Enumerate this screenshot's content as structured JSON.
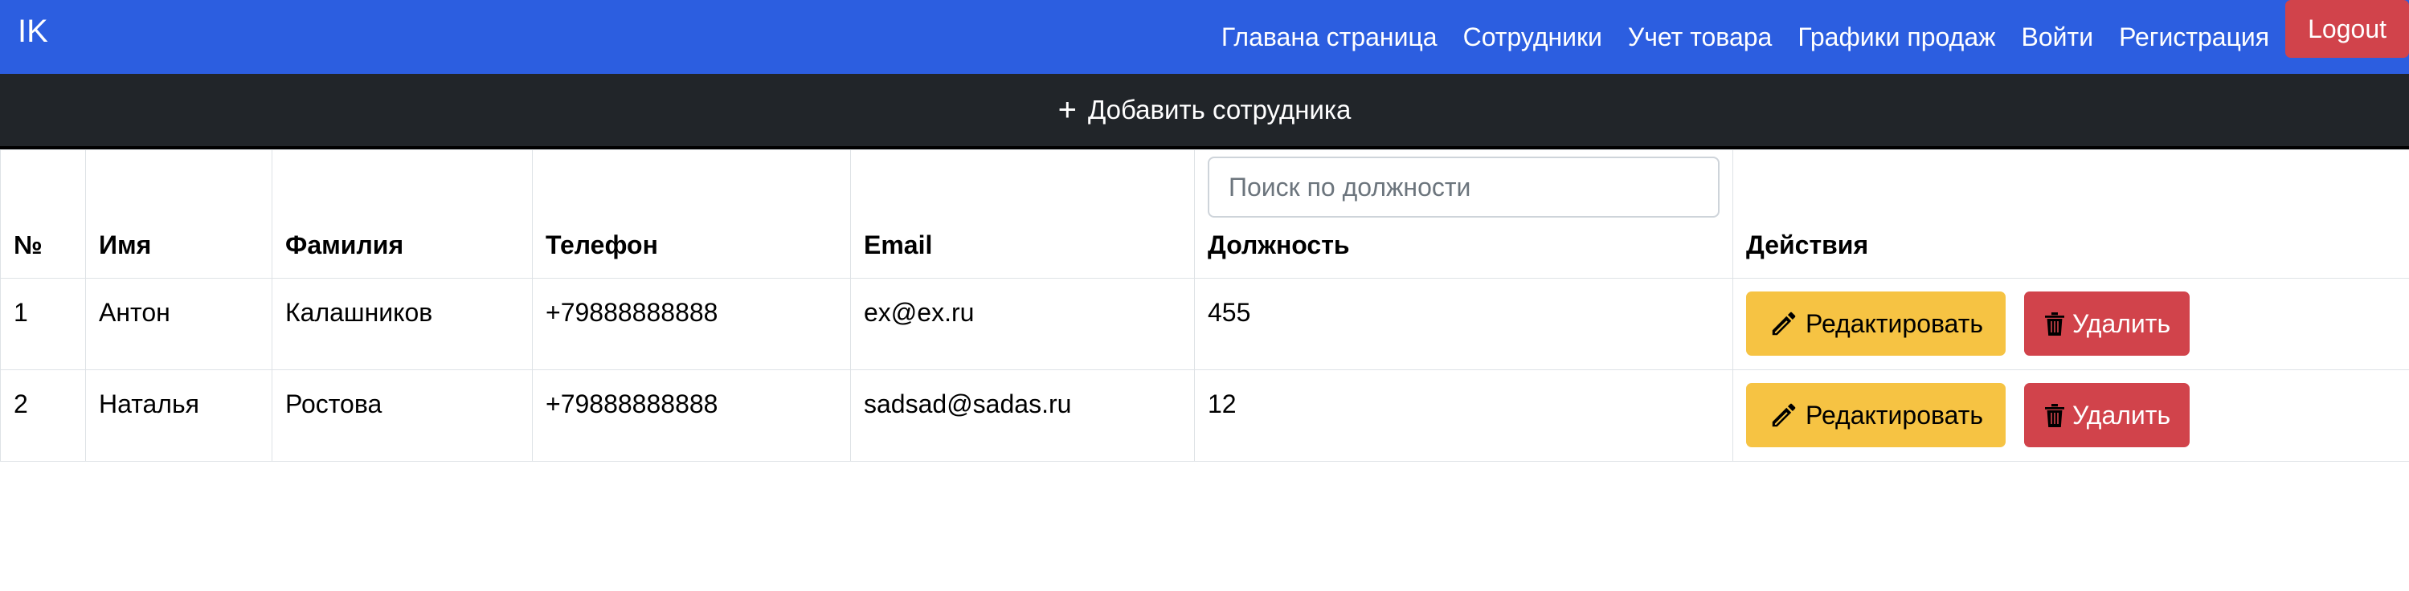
{
  "navbar": {
    "brand": "IK",
    "links": [
      "Главана страница",
      "Сотрудники",
      "Учет товара",
      "Графики продаж",
      "Войти",
      "Регистрация"
    ],
    "logout_label": "Logout",
    "bg_color": "#2c5ee0",
    "logout_color": "#d1434b"
  },
  "addbar": {
    "icon": "plus-icon",
    "label": "Добавить сотрудника",
    "bg_color": "#212529"
  },
  "table": {
    "search_placeholder": "Поиск по должности",
    "columns": [
      "№",
      "Имя",
      "Фамилия",
      "Телефон",
      "Email",
      "Должность",
      "Действия"
    ],
    "rows": [
      [
        "1",
        "Антон",
        "Калашников",
        "+79888888888",
        "ex@ex.ru",
        "455"
      ],
      [
        "2",
        "Наталья",
        "Ростова",
        "+79888888888",
        "sadsad@sadas.ru",
        "12"
      ]
    ],
    "edit_label": "Редактировать",
    "delete_label": "Удалить",
    "edit_icon": "pencil-icon",
    "delete_icon": "trash-icon",
    "edit_color": "#f6c343",
    "delete_color": "#d1434b"
  }
}
